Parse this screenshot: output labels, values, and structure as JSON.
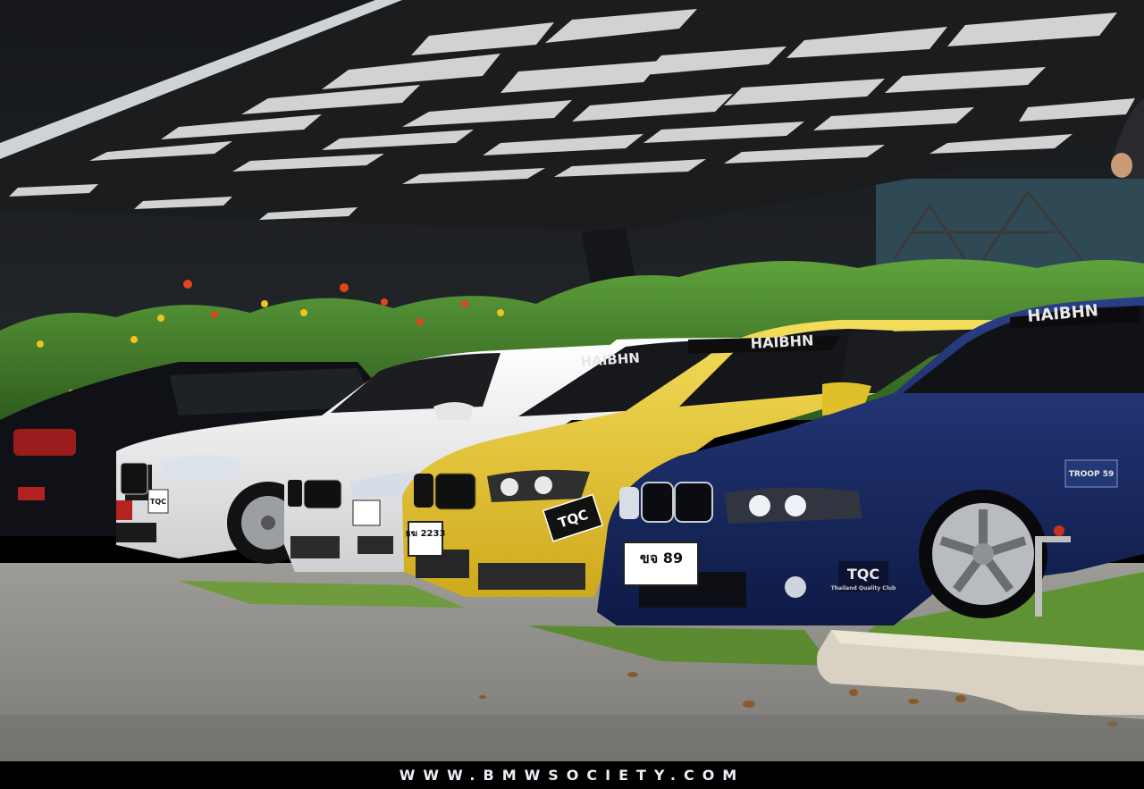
{
  "watermark": "WWW.BMWSOCIETY.COM",
  "stickers": {
    "tqc_main": "TQC",
    "tqc_sub": "Thailand Quality Club",
    "troop": "TROOP 59",
    "windshield": "HAIBHN"
  },
  "plates": {
    "yellow_car": "ธฆ 2233",
    "blue_car": "ขจ 89",
    "white_car": "ก"
  },
  "colors": {
    "blue_car": "#13235a",
    "yellow_car": "#e6c52a",
    "white_car": "#f2f2f2",
    "black_car": "#0f1116",
    "canopy": "#1c1d1f",
    "grass": "#5c8a34",
    "asphalt": "#8f8e8a"
  }
}
